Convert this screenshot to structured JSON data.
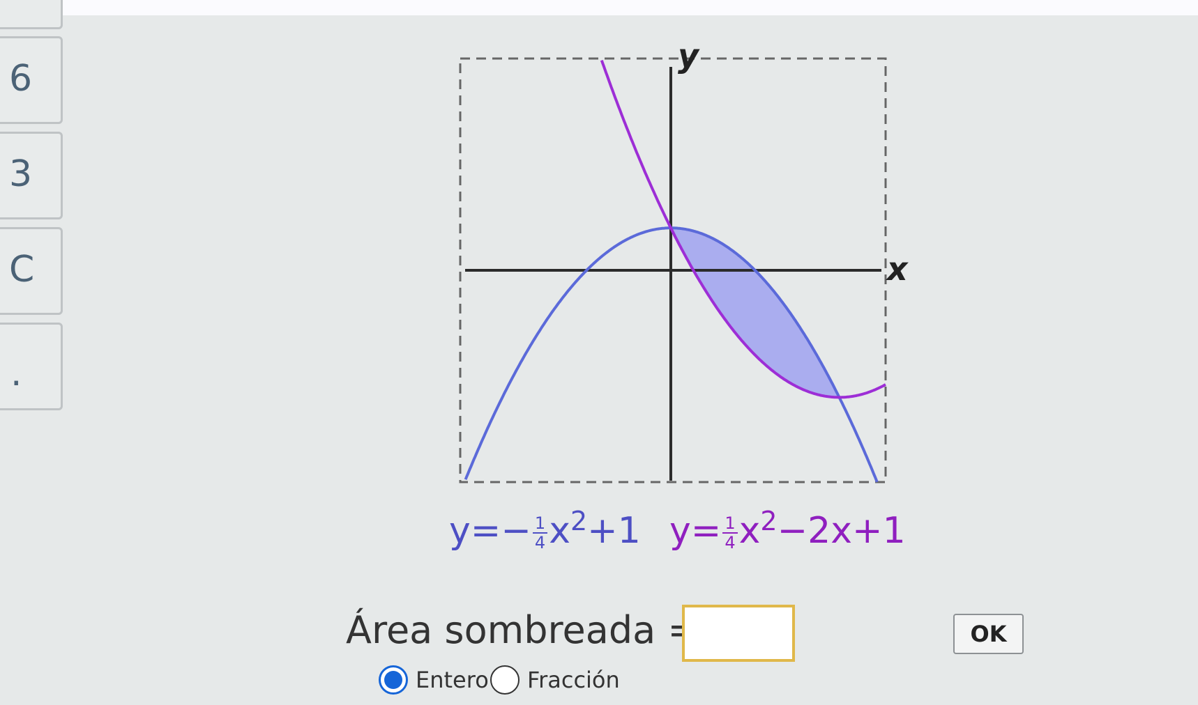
{
  "keypad": {
    "keys": [
      {
        "label": "6"
      },
      {
        "label": "3"
      },
      {
        "label": "C"
      },
      {
        "label": "."
      }
    ]
  },
  "graph": {
    "x_axis_label": "x",
    "y_axis_label": "y",
    "colors": {
      "curve1": "#5b6ad9",
      "curve2": "#9d2ed6",
      "shade": "#a3a6f0",
      "axes": "#2b2b2b",
      "frame": "#666666"
    },
    "equation1": {
      "prefix": "y=−",
      "frac_num": "1",
      "frac_den": "4",
      "base": "x",
      "exp": "2",
      "suffix": "+1"
    },
    "equation2": {
      "prefix": "y=",
      "frac_num": "1",
      "frac_den": "4",
      "base": "x",
      "exp": "2",
      "suffix": "−2x+1"
    },
    "chart_data": {
      "type": "area",
      "series": [
        {
          "name": "y=−¼x²+1",
          "a": -0.25,
          "b": 0,
          "c": 1
        },
        {
          "name": "y=¼x²−2x+1",
          "a": 0.25,
          "b": -2,
          "c": 1
        }
      ],
      "shaded_region": [
        0,
        4
      ],
      "xlim": [
        -5,
        5.1
      ],
      "ylim": [
        -5,
        5
      ],
      "grid": false
    }
  },
  "answer": {
    "label": "Área sombreada =",
    "value": "",
    "placeholder": ""
  },
  "ok_button": {
    "label": "OK"
  },
  "answer_type": {
    "options": [
      {
        "label": "Entero",
        "selected": true
      },
      {
        "label": "Fracción",
        "selected": false
      }
    ]
  }
}
